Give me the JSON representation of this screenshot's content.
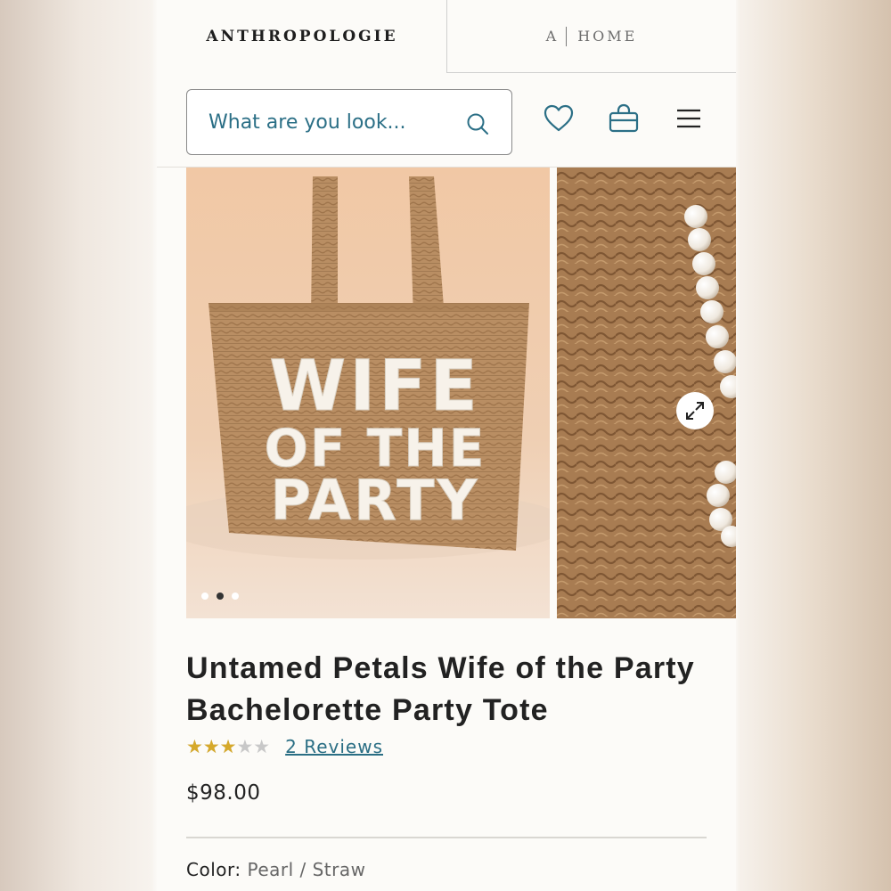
{
  "brand": {
    "primary": "ANTHROPOLOGIE",
    "home_mark": "A",
    "home_label": "HOME"
  },
  "search": {
    "placeholder": "What are you look..."
  },
  "header_icons": [
    "heart-icon",
    "shopping-bag-icon",
    "menu-icon"
  ],
  "product": {
    "title": "Untamed Petals Wife of the Party Bachelorette Party Tote",
    "rating": 3,
    "rating_max": 5,
    "reviews_label": "2 Reviews",
    "price": "$98.00",
    "color_label": "Color:",
    "color_value": "Pearl / Straw",
    "bag_text": [
      "WIFE",
      "OF THE",
      "PARTY"
    ]
  },
  "gallery": {
    "slide_count": 3,
    "active_slide": 2
  },
  "colors": {
    "accent": "#2b6f86",
    "star": "#d6a92a",
    "straw": "#b58a5e"
  }
}
